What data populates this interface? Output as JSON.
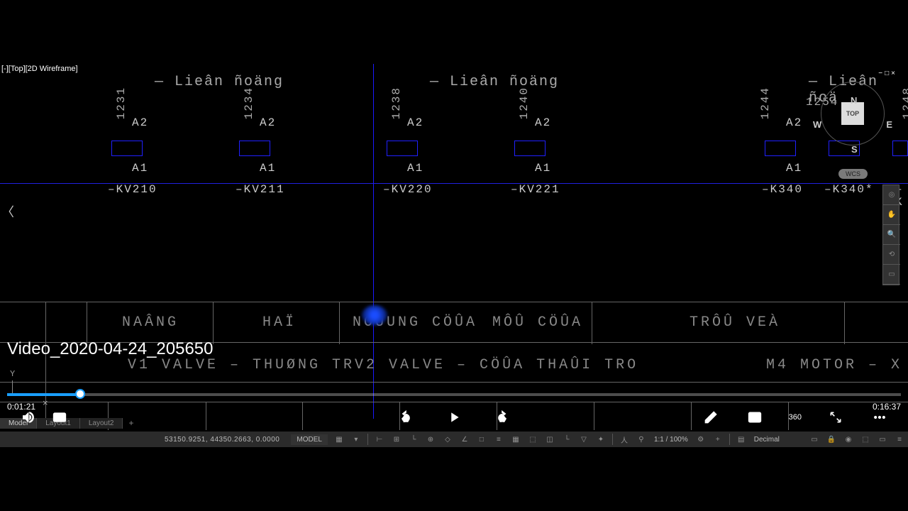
{
  "viewport": {
    "label": "[-][Top][2D Wireframe]"
  },
  "viewcube": {
    "face": "TOP",
    "n": "N",
    "s": "S",
    "w": "W",
    "e": "E",
    "wcs": "WCS"
  },
  "schematic": {
    "lien1": "— Lieân ñoäng",
    "lien2": "— Lieân ñoäng",
    "lien3": "— Lieân ñoä",
    "v1231": "1231",
    "v1234": "1234",
    "v1238": "1238",
    "v1240": "1240",
    "v1244": "1244",
    "v1248": "1248",
    "v1254": "1254",
    "a1": "A1",
    "a2": "A2",
    "kv210": "–KV210",
    "kv211": "–KV211",
    "kv220": "–KV220",
    "kv221": "–KV221",
    "k340": "–K340",
    "k340s": "–K340*"
  },
  "table": {
    "naang": "NAÂNG",
    "hai": "HAÏ",
    "noung": "NOÙUNG CÖÛA",
    "moucoua": "MÔÛ CÖÛA",
    "trovea": "TRÔÛ VEÀ",
    "v1valve": "V1 VALVE – THUØNG TRV2 VALVE – CÖÛA THAÛI TRO",
    "m4motor": "M4 MOTOR – X"
  },
  "video": {
    "title": "Video_2020-04-24_205650",
    "current": "0:01:21",
    "total": "0:16:37",
    "progress_pct": 8.2,
    "skip_back": "10",
    "skip_fwd": "30",
    "vr": "360"
  },
  "tabs": {
    "model": "Model",
    "l1": "Layout1",
    "l2": "Layout2"
  },
  "status": {
    "coords": "53150.9251, 44350.2663, 0.0000",
    "model": "MODEL",
    "zoom": "1:1 / 100%",
    "units": "Decimal"
  },
  "overlay": {
    "y": "Y",
    "x": "×"
  }
}
